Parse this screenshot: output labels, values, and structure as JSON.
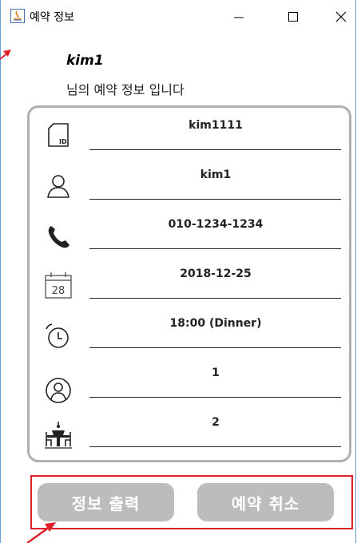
{
  "window": {
    "title": "예약 정보"
  },
  "header": {
    "username": "kim1",
    "subtitle": "님의 예약 정보 입니다"
  },
  "fields": [
    {
      "icon": "id-card-icon",
      "value": "kim1111"
    },
    {
      "icon": "person-icon",
      "value": "kim1"
    },
    {
      "icon": "phone-icon",
      "value": "010-1234-1234"
    },
    {
      "icon": "calendar-icon",
      "value": "2018-12-25",
      "calendar_day": "28"
    },
    {
      "icon": "alarm-clock-icon",
      "value": "18:00 (Dinner)"
    },
    {
      "icon": "people-icon",
      "value": "1"
    },
    {
      "icon": "table-icon",
      "value": "2"
    }
  ],
  "buttons": {
    "print_label": "정보 출력",
    "cancel_label": "예약 취소"
  },
  "colors": {
    "window_border": "#6b9bd1",
    "panel_border": "#b0b0b0",
    "button_bg": "#bcbcbc",
    "annotation": "#e0202a"
  }
}
